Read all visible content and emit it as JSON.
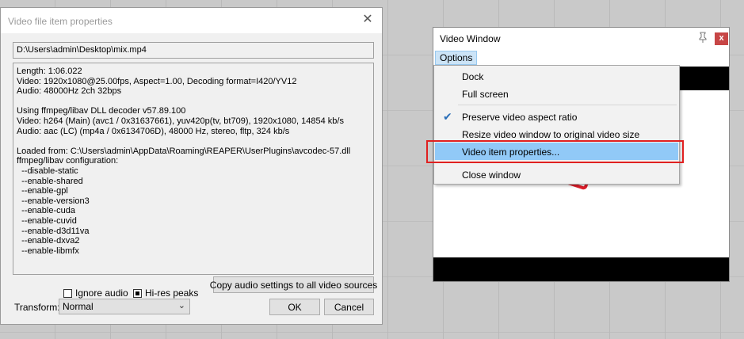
{
  "dialog": {
    "title": "Video file item properties",
    "close_glyph": "✕",
    "path": "D:\\Users\\admin\\Desktop\\mix.mp4",
    "info_lines": [
      "Length: 1:06.022",
      "Video: 1920x1080@25.00fps, Aspect=1.00, Decoding format=I420/YV12",
      "Audio: 48000Hz 2ch 32bps",
      "",
      "Using ffmpeg/libav DLL decoder v57.89.100",
      "Video: h264 (Main) (avc1 / 0x31637661), yuv420p(tv, bt709), 1920x1080, 14854 kb/s",
      "Audio: aac (LC) (mp4a / 0x6134706D), 48000 Hz, stereo, fltp, 324 kb/s",
      "",
      "Loaded from: C:\\Users\\admin\\AppData\\Roaming\\REAPER\\UserPlugins\\avcodec-57.dll",
      "ffmpeg/libav configuration:",
      "  --disable-static",
      "  --enable-shared",
      "  --enable-gpl",
      "  --enable-version3",
      "  --enable-cuda",
      "  --enable-cuvid",
      "  --enable-d3d11va",
      "  --enable-dxva2",
      "  --enable-libmfx"
    ],
    "ignore_audio": {
      "label": "Ignore audio",
      "checked": false
    },
    "hires_peaks": {
      "label": "Hi-res peaks",
      "checked": true
    },
    "copy_audio_button": "Copy audio settings to all video sources",
    "transform_label": "Transform:",
    "transform_value": "Normal",
    "ok_button": "OK",
    "cancel_button": "Cancel"
  },
  "video_window": {
    "title": "Video Window",
    "pin_icon": "pin-icon",
    "close_glyph": "x",
    "menu_options": "Options"
  },
  "context_menu": {
    "items": [
      {
        "label": "Dock",
        "checked": false
      },
      {
        "label": "Full screen",
        "checked": false
      },
      {
        "label": "Preserve video aspect ratio",
        "checked": true
      },
      {
        "label": "Resize video window to original video size",
        "checked": false
      },
      {
        "label": "Video item properties...",
        "checked": false,
        "highlighted": true
      },
      {
        "label": "Close window",
        "checked": false
      }
    ],
    "check_glyph": "✔"
  },
  "colors": {
    "highlight": "#91c9f7",
    "callout": "#e02020",
    "close_button": "#c74646",
    "menu_bar_active": "#cce4f7"
  }
}
